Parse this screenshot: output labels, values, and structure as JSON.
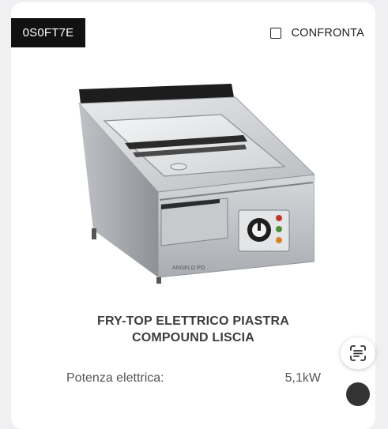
{
  "product": {
    "code": "0S0FT7E",
    "compare_label": "CONFRONTA",
    "compare_checked": false,
    "image_icon": "fry-top-griddle-appliance-illustration",
    "brand_mark": "ANGELO PO",
    "title_line1": "FRY-TOP ELETTRICO PIASTRA",
    "title_line2": "COMPOUND LISCIA"
  },
  "specs": [
    {
      "label": "Potenza elettrica:",
      "value": "5,1kW"
    }
  ],
  "floating": {
    "scan_icon": "text-scan-icon"
  },
  "colors": {
    "badge_bg": "#111111",
    "lamp_red": "#c0392b",
    "lamp_green": "#4a8f3c",
    "lamp_amber": "#d9822b"
  }
}
